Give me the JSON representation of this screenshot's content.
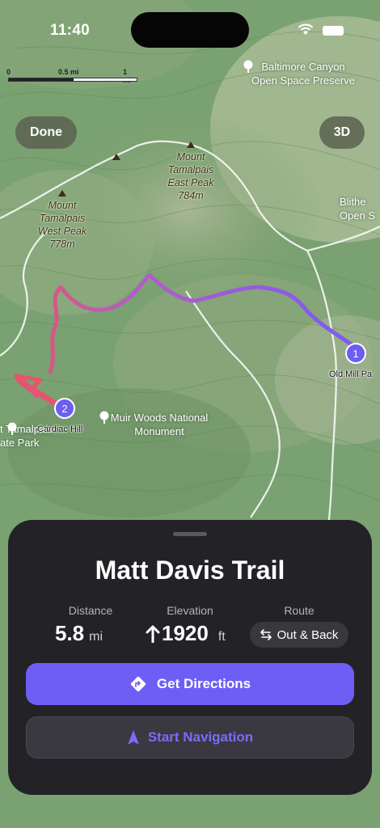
{
  "status_bar": {
    "time": "11:40"
  },
  "scale_bar": {
    "labels": [
      "0",
      "0.5 mi",
      "1 mi"
    ]
  },
  "map_controls": {
    "done_label": "Done",
    "view_3d_label": "3D"
  },
  "map_labels": {
    "baltimore": "Baltimore Canyon\nOpen Space Preserve",
    "east_peak": "Mount\nTamalpais\nEast Peak\n784m",
    "west_peak": "Mount\nTamalpais\nWest Peak\n778m",
    "blithe": "Blithe\nOpen S",
    "muir_woods": "Muir Woods National\nMonument",
    "tamalpais_park": "t Tamalpais\nate Park"
  },
  "markers": [
    {
      "number": "1",
      "label": "Old Mill Pa"
    },
    {
      "number": "2",
      "label": "Cardiac Hill"
    }
  ],
  "trail": {
    "title": "Matt Davis Trail",
    "distance_label": "Distance",
    "distance_value": "5.8",
    "distance_unit": "mi",
    "elevation_label": "Elevation",
    "elevation_value": "1920",
    "elevation_unit": "ft",
    "route_label": "Route",
    "route_value": "Out & Back"
  },
  "actions": {
    "directions_label": "Get Directions",
    "navigation_label": "Start Navigation"
  },
  "colors": {
    "accent": "#6f5ef5",
    "route_start": "#e8546a",
    "route_mid": "#b45cc8",
    "route_end": "#7a5cf0",
    "sheet_bg": "#232226"
  }
}
